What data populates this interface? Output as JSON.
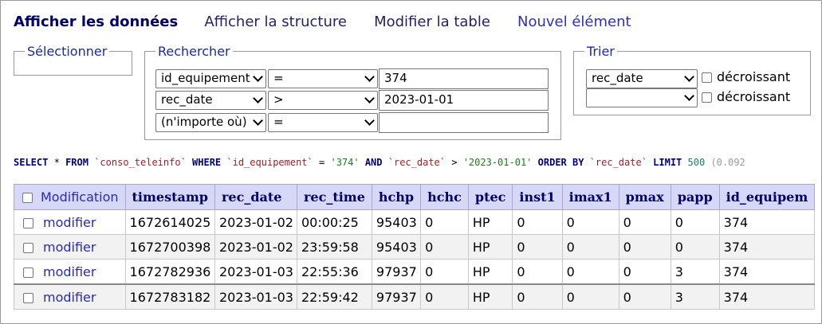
{
  "menu": {
    "active": "Afficher les données",
    "links": [
      "Afficher la structure",
      "Modifier la table",
      "Nouvel élément"
    ]
  },
  "select_box": {
    "legend": "Sélectionner"
  },
  "search": {
    "legend": "Rechercher",
    "rows": [
      {
        "column": "id_equipement",
        "op": "=",
        "value": "374"
      },
      {
        "column": "rec_date",
        "op": ">",
        "value": "2023-01-01"
      },
      {
        "column": "(n'importe où)",
        "op": "=",
        "value": ""
      }
    ]
  },
  "sort": {
    "legend": "Trier",
    "rows": [
      {
        "column": "rec_date",
        "desc_label": "décroissant",
        "desc_checked": false
      },
      {
        "column": "",
        "desc_label": "décroissant",
        "desc_checked": false
      }
    ]
  },
  "sql": {
    "select": "SELECT",
    "star": "*",
    "from": "FROM",
    "table": "`conso_teleinfo`",
    "where": "WHERE",
    "col1": "`id_equipement`",
    "eq": "=",
    "val1": "'374'",
    "and": "AND",
    "col2": "`rec_date`",
    "gt": ">",
    "val2": "'2023-01-01'",
    "orderby": "ORDER BY",
    "col3": "`rec_date`",
    "limit": "LIMIT",
    "limit_val": "500",
    "timing": "(0.092"
  },
  "table": {
    "modification_header": "Modification",
    "columns": [
      "timestamp",
      "rec_date",
      "rec_time",
      "hchp",
      "hchc",
      "ptec",
      "inst1",
      "imax1",
      "pmax",
      "papp",
      "id_equipem"
    ],
    "edit_label": "modifier",
    "rows": [
      [
        "1672614025",
        "2023-01-02",
        "00:00:25",
        "95403",
        "0",
        "HP",
        "0",
        "0",
        "0",
        "0",
        "374"
      ],
      [
        "1672700398",
        "2023-01-02",
        "23:59:58",
        "95403",
        "0",
        "HP",
        "0",
        "0",
        "0",
        "0",
        "374"
      ],
      [
        "1672782936",
        "2023-01-03",
        "22:55:36",
        "97937",
        "0",
        "HP",
        "0",
        "0",
        "0",
        "3",
        "374"
      ],
      [
        "1672783182",
        "2023-01-03",
        "22:59:42",
        "97937",
        "0",
        "HP",
        "0",
        "0",
        "0",
        "3",
        "374"
      ]
    ]
  }
}
